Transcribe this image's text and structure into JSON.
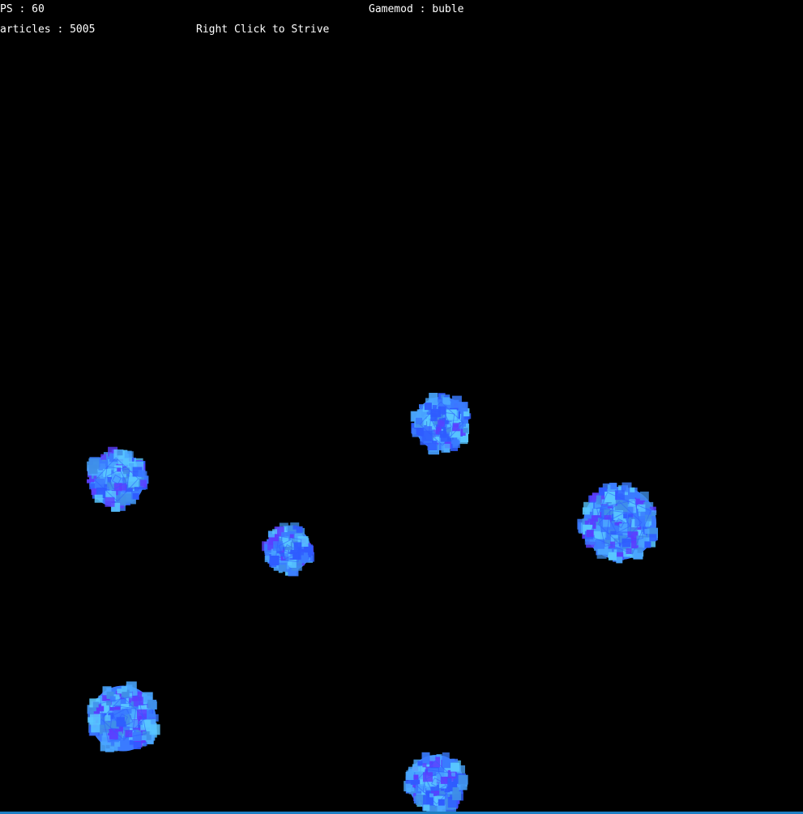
{
  "hud": {
    "fps_text": "PS : 60",
    "gamemode_text": "Gamemod : buble",
    "particles_text": "articles : 5005",
    "hint_text": "Right Click to Strive"
  },
  "colors": {
    "background": "#000000",
    "hud_text": "#ffffff",
    "bubble_palette": [
      "#3a7bff",
      "#4aa6ff",
      "#2f5cff",
      "#5b3dff",
      "#58c6ff",
      "#3f8fe8"
    ],
    "bottom_edge": "#1e7fc4"
  },
  "scene": {
    "particle_count": 5005,
    "bubble_count": 6
  }
}
